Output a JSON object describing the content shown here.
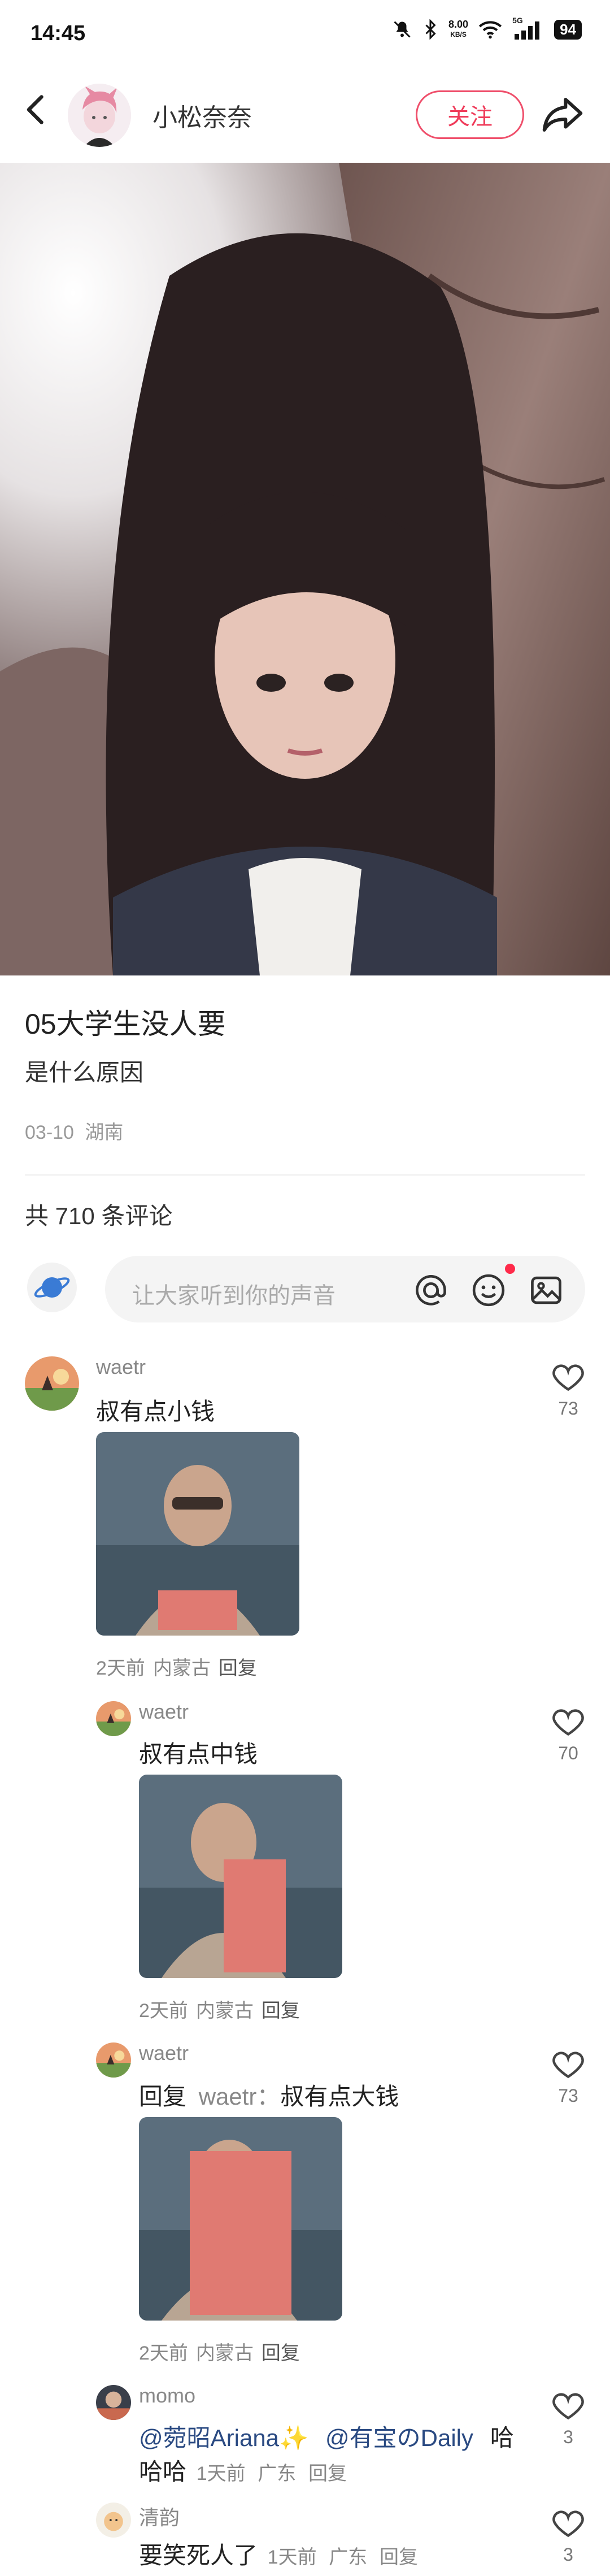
{
  "status_bar": {
    "time": "14:45",
    "speed_value": "8.00",
    "speed_unit": "KB/S",
    "network": "5G",
    "battery": "94"
  },
  "nav": {
    "author_name": "小松奈奈",
    "follow_label": "关注"
  },
  "post": {
    "title": "05大学生没人要",
    "body": "是什么原因",
    "date": "03-10",
    "location": "湖南"
  },
  "comments_header": {
    "count_label": "共 710 条评论"
  },
  "comment_input": {
    "placeholder": "让大家听到你的声音"
  },
  "comments": [
    {
      "user": "waetr",
      "text": "叔有点小钱",
      "time": "2天前",
      "location": "内蒙古",
      "reply": "回复",
      "likes": "73"
    },
    {
      "user": "waetr",
      "text": "叔有点中钱",
      "time": "2天前",
      "location": "内蒙古",
      "reply": "回复",
      "likes": "70"
    },
    {
      "user": "waetr",
      "reply_prefix": "回复",
      "reply_to": "waetr：",
      "text": "叔有点大钱",
      "time": "2天前",
      "location": "内蒙古",
      "reply": "回复",
      "likes": "73"
    },
    {
      "user": "momo",
      "mention1": "@菀昭Ariana✨",
      "mention2": "@有宝のDaily",
      "text_end": "哈",
      "text_line2": "哈哈",
      "time": "1天前",
      "location": "广东",
      "reply": "回复",
      "likes": "3"
    },
    {
      "user": "清韵",
      "text": "要笑死人了",
      "time": "1天前",
      "location": "广东",
      "reply": "回复",
      "likes": "3"
    }
  ],
  "colors": {
    "accent": "#ef3b5a",
    "mention": "#2a4a82",
    "muted": "#888888"
  }
}
